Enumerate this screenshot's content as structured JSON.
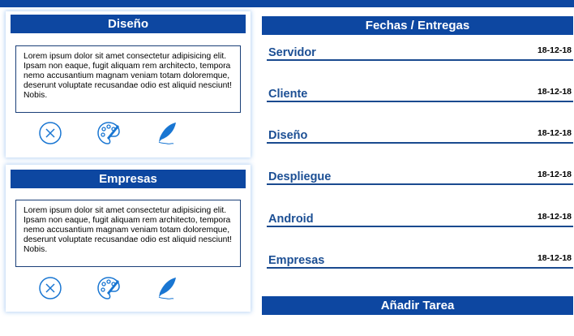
{
  "cards": [
    {
      "title": "Diseño",
      "text": "Lorem ipsum dolor sit amet consectetur adipisicing elit. Ipsam non eaque, fugit aliquam rem architecto, tempora nemo accusantium magnam veniam totam doloremque, deserunt voluptate recusandae odio est aliquid nesciunt! Nobis.",
      "icons": [
        "close-circle-icon",
        "palette-icon",
        "feather-icon"
      ]
    },
    {
      "title": "Empresas",
      "text": "Lorem ipsum dolor sit amet consectetur adipisicing elit. Ipsam non eaque, fugit aliquam rem architecto, tempora nemo accusantium magnam veniam totam doloremque, deserunt voluptate recusandae odio est aliquid nesciunt! Nobis.",
      "icons": [
        "close-circle-icon",
        "palette-icon",
        "feather-icon"
      ]
    }
  ],
  "dates": {
    "title": "Fechas / Entregas",
    "items": [
      {
        "label": "Servidor",
        "date": "18-12-18"
      },
      {
        "label": "Cliente",
        "date": "18-12-18"
      },
      {
        "label": "Diseño",
        "date": "18-12-18"
      },
      {
        "label": "Despliegue",
        "date": "18-12-18"
      },
      {
        "label": "Android",
        "date": "18-12-18"
      },
      {
        "label": "Empresas",
        "date": "18-12-18"
      }
    ]
  },
  "add_task": {
    "title": "Añadir Tarea"
  },
  "colors": {
    "primary": "#0d47a1",
    "link": "#1c4f94",
    "icon": "#1976d2"
  }
}
